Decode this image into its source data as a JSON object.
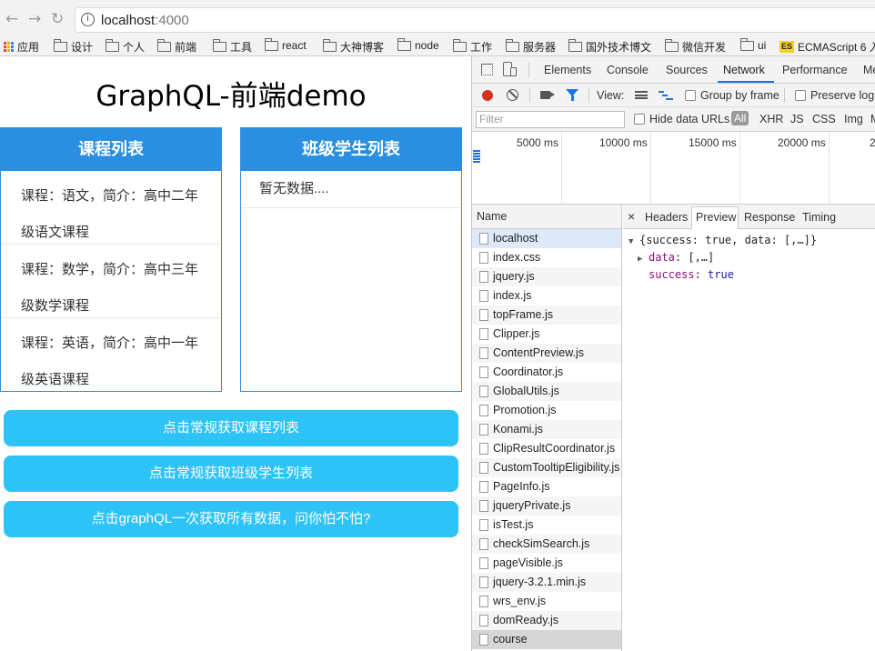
{
  "browser": {
    "url_host": "localhost",
    "url_port": ":4000",
    "back_glyph": "←",
    "forward_glyph": "→",
    "reload_glyph": "↻",
    "info_glyph": "i"
  },
  "bookmarks": {
    "apps_label": "应用",
    "items": [
      "设计",
      "个人",
      "前端",
      "工具",
      "react",
      "大神博客",
      "node",
      "工作",
      "服务器",
      "国外技术博文",
      "微信开发",
      "ui"
    ],
    "es_badge": "ES",
    "es_label": "ECMAScript 6 入"
  },
  "page": {
    "title": "GraphQL-前端demo",
    "course_panel_title": "课程列表",
    "class_panel_title": "班级学生列表",
    "courses": [
      "课程：语文，简介：高中二年级语文课程",
      "课程：数学，简介：高中三年级数学课程",
      "课程：英语，简介：高中一年级英语课程"
    ],
    "class_empty_text": "暂无数据....",
    "buttons": {
      "fetch_courses": "点击常规获取课程列表",
      "fetch_students": "点击常规获取班级学生列表",
      "fetch_graphql": "点击graphQL一次获取所有数据，问你怕不怕?"
    }
  },
  "devtools": {
    "tabs": [
      "Elements",
      "Console",
      "Sources",
      "Network",
      "Performance",
      "Me"
    ],
    "active_tab": "Network",
    "toolbar": {
      "view_label": "View:",
      "group_by_frame": "Group by frame",
      "preserve_log": "Preserve log"
    },
    "filter": {
      "placeholder": "Filter",
      "hide_data_urls": "Hide data URLs",
      "types": [
        "All",
        "XHR",
        "JS",
        "CSS",
        "Img",
        "M"
      ]
    },
    "timeline_ticks": [
      "5000 ms",
      "10000 ms",
      "15000 ms",
      "20000 ms",
      "2"
    ],
    "name_header": "Name",
    "requests": [
      "localhost",
      "index.css",
      "jquery.js",
      "index.js",
      "topFrame.js",
      "Clipper.js",
      "ContentPreview.js",
      "Coordinator.js",
      "GlobalUtils.js",
      "Promotion.js",
      "Konami.js",
      "ClipResultCoordinator.js",
      "CustomTooltipEligibility.js",
      "PageInfo.js",
      "jqueryPrivate.js",
      "isTest.js",
      "checkSimSearch.js",
      "pageVisible.js",
      "jquery-3.2.1.min.js",
      "wrs_env.js",
      "domReady.js",
      "course"
    ],
    "detail_tabs": {
      "close": "×",
      "headers": "Headers",
      "preview": "Preview",
      "response": "Response",
      "timing": "Timing"
    },
    "preview": {
      "root": "{success: true, data: [,…]}",
      "data_key": "data",
      "data_val": "[,…]",
      "success_key": "success",
      "success_val": "true"
    }
  }
}
